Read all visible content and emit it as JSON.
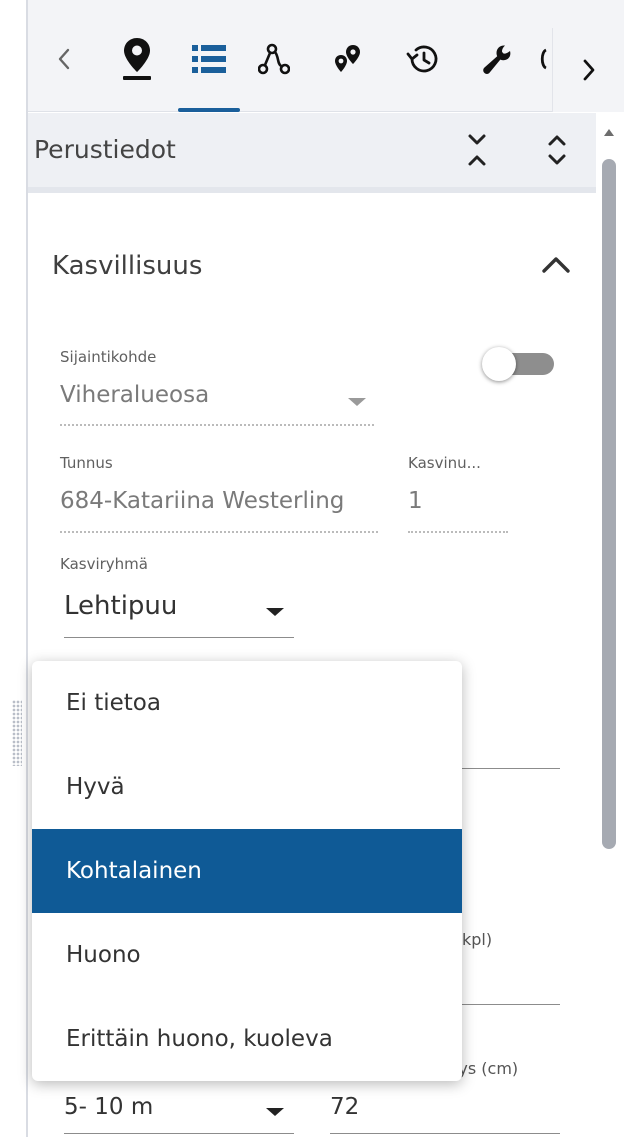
{
  "toolbar": {
    "tabs": [
      {
        "icon": "map-pin-icon",
        "active": false
      },
      {
        "icon": "list-icon",
        "active": true
      },
      {
        "icon": "route-icon",
        "active": false
      },
      {
        "icon": "locations-icon",
        "active": false
      },
      {
        "icon": "history-icon",
        "active": false
      },
      {
        "icon": "wrench-icon",
        "active": false
      }
    ],
    "prev_label": "‹",
    "next_label": "›"
  },
  "section": {
    "title": "Perustiedot"
  },
  "group": {
    "title": "Kasvillisuus"
  },
  "fields": {
    "sijaintikohde": {
      "label": "Sijaintikohde",
      "value": "Viheralueosa"
    },
    "tunnus": {
      "label": "Tunnus",
      "value": "684-Katariina Westerling"
    },
    "kasvinumero": {
      "label": "Kasvinu...",
      "value": "1"
    },
    "kasviryhma": {
      "label": "Kasviryhmä",
      "value": "Lehtipuu"
    },
    "partial_kpl_label": "kpl)",
    "partial_cm_label": "ärys (cm)",
    "korkeus": {
      "value": "5- 10 m"
    },
    "ymparys": {
      "value": "72"
    }
  },
  "dropdown": {
    "options": [
      "Ei tietoa",
      "Hyvä",
      "Kohtalainen",
      "Huono",
      "Erittäin huono, kuoleva"
    ],
    "selected": "Kohtalainen"
  },
  "colors": {
    "accent": "#1a5f9b",
    "selected_bg": "#0f5a96",
    "toolbar_bg": "#f3f4f7"
  }
}
